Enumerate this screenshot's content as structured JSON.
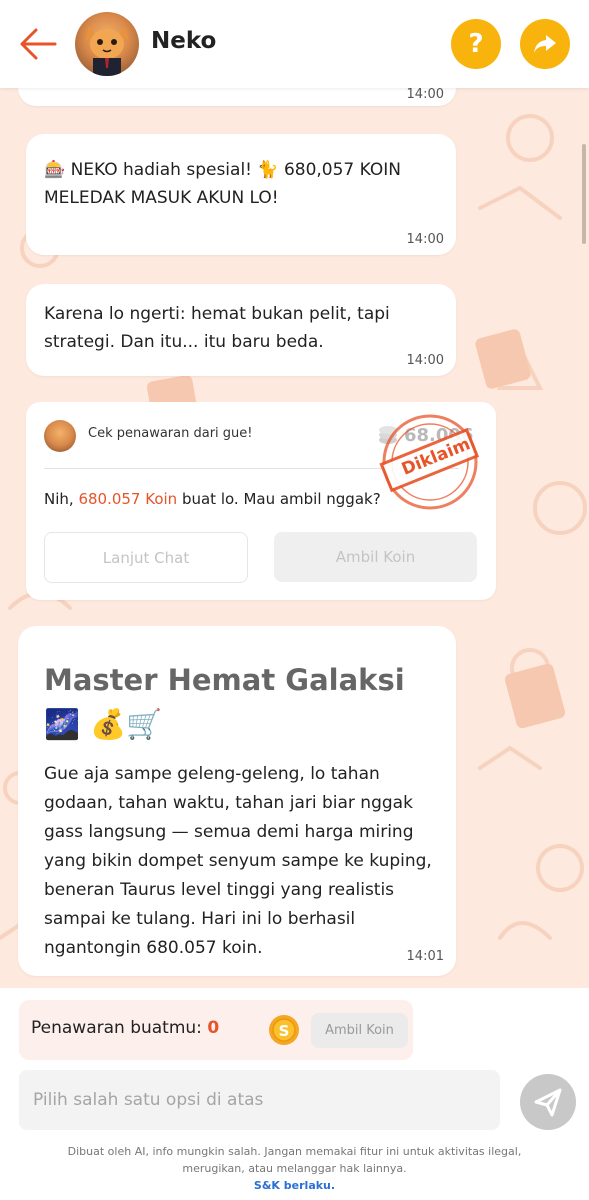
{
  "header": {
    "title": "Neko",
    "help_label": "?",
    "share_label": "➦"
  },
  "messages": [
    {
      "text": "",
      "time": "14:00"
    },
    {
      "text": "🎰 NEKO hadiah spesial! 🐈 680,057 KOIN MELEDAK MASUK AKUN LO!",
      "time": "14:00"
    },
    {
      "text": "Karena lo ngerti: hemat bukan pelit, tapi strategi. Dan itu... itu baru beda.",
      "time": "14:00"
    }
  ],
  "offer_card": {
    "header_text": "Cek penawaran dari gue!",
    "amount": "68.006",
    "stamp_text": "Diklaim",
    "body_prefix": "Nih, ",
    "body_highlight": "680.057 Koin",
    "body_suffix": " buat lo. Mau ambil nggak?",
    "continue_label": "Lanjut Chat",
    "claim_label": "Ambil Koin"
  },
  "long_message": {
    "title": "Master Hemat Galaksi 🌌 💰🛒",
    "body": "Gue aja sampe geleng-geleng, lo tahan godaan, tahan waktu, tahan jari biar nggak gass langsung — semua demi harga miring yang bikin dompet senyum sampe ke kuping, beneran Taurus level tinggi yang realistis sampai ke tulang. Hari ini lo berhasil ngantongin 680.057 koin.",
    "time": "14:01"
  },
  "offer_bar": {
    "label": "Penawaran buatmu:",
    "count": "0",
    "button_label": "Ambil Koin"
  },
  "input": {
    "placeholder": "Pilih salah satu opsi di atas"
  },
  "disclaimer": {
    "line1": "Dibuat oleh AI, info mungkin salah. Jangan memakai fitur ini untuk aktivitas ilegal,",
    "line2": "merugikan, atau melanggar hak lainnya.",
    "link": "S&K berlaku."
  },
  "colors": {
    "accent": "#f9b30d",
    "back_arrow": "#e8542a",
    "highlight": "#e8542a",
    "stamp": "#e8542a",
    "link": "#2a6fd6",
    "background": "#fde9de"
  },
  "icons": [
    "back-arrow-icon",
    "help-icon",
    "share-icon",
    "send-icon",
    "coin-icon",
    "coin-stack-icon"
  ]
}
